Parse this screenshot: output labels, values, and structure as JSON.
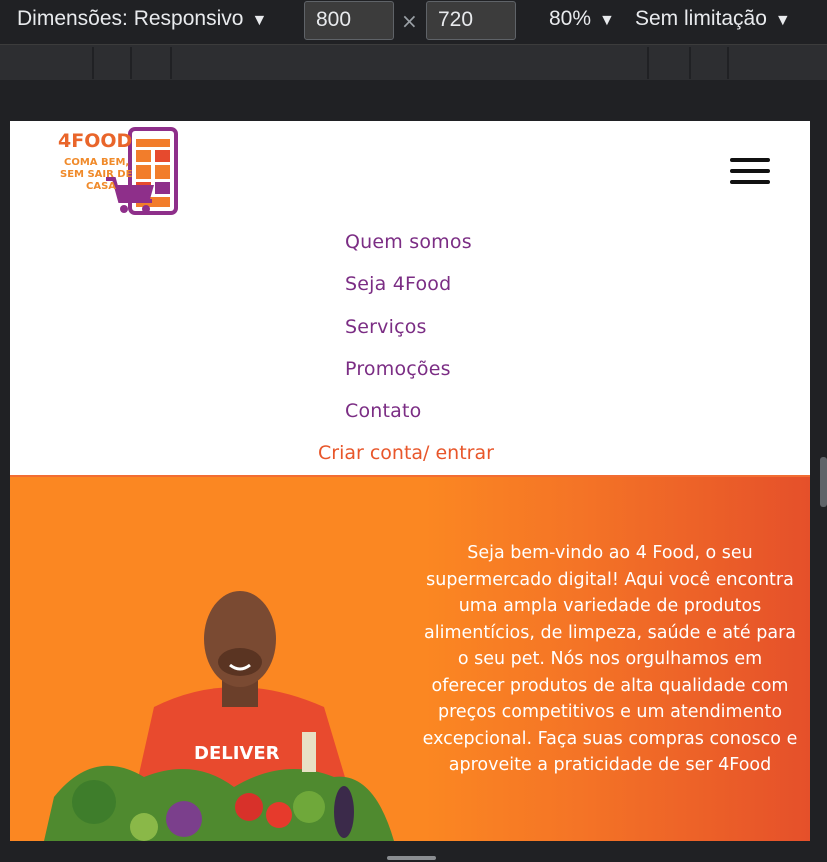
{
  "devtools": {
    "dimensions_label": "Dimensões: Responsivo",
    "width_value": "800",
    "times_symbol": "×",
    "height_value": "720",
    "zoom_label": "80%",
    "throttle_label": "Sem limitação",
    "dropdown_arrow": "▼"
  },
  "site": {
    "logo": {
      "brand": "4FOOD",
      "tagline_line1": "COMA BEM,",
      "tagline_line2": "SEM SAIR DE",
      "tagline_line3": "CASA"
    },
    "menu_icon": "hamburger-menu-icon",
    "nav": [
      {
        "label": "Quem somos"
      },
      {
        "label": "Seja 4Food"
      },
      {
        "label": "Serviços"
      },
      {
        "label": "Promoções"
      },
      {
        "label": "Contato"
      }
    ],
    "cta_label": "Criar conta/ entrar",
    "hero": {
      "text": "Seja bem-vindo ao 4 Food, o seu supermercado digital! Aqui você encontra uma ampla variedade de produtos alimentícios, de limpeza, saúde e até para o seu pet. Nós nos orgulhamos em oferecer produtos de alta qualidade com preços competitivos e um atendimento excepcional. Faça suas compras conosco e aproveite a praticidade de ser 4Food",
      "shirt_text": "DELIVER"
    },
    "colors": {
      "nav_purple": "#7b2d84",
      "accent_orange": "#e8562a",
      "hero_orange": "#fb8722",
      "hero_red": "#e5502a"
    }
  }
}
